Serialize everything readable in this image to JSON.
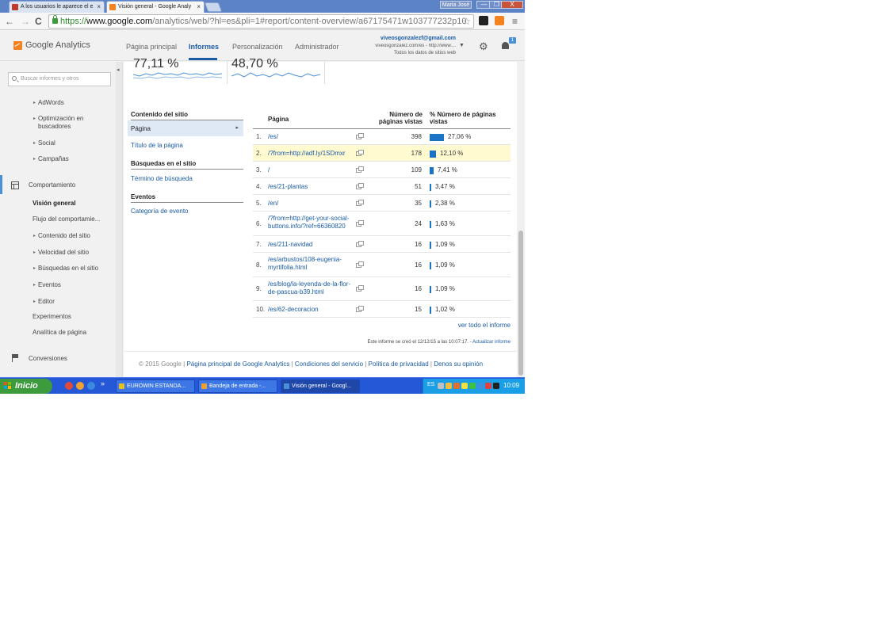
{
  "browser": {
    "tabs": [
      {
        "title": "A los usuarios le aparece el e",
        "favicon_color": "#c0392b"
      },
      {
        "title": "Visión general - Google Analy",
        "favicon_color": "#f58220"
      }
    ],
    "tab_close_glyph": "×",
    "username": "Maria José",
    "window_minimize": "—",
    "window_maximize": "❐",
    "window_close": "X",
    "url_scheme": "https://",
    "url_host": "www.google.com",
    "url_rest": "/analytics/web/?hl=es&pli=1#report/content-overview/a67175471w103777232p10",
    "nav_back": "←",
    "nav_forward": "→",
    "nav_reload": "C",
    "menu_glyph": "≡"
  },
  "ga": {
    "logo_text": "Google Analytics",
    "nav": [
      "Página principal",
      "Informes",
      "Personalización",
      "Administrador"
    ],
    "account_email": "viveosgonzalezf@gmail.com",
    "account_property": "viveosgonzalez.com/es - http://www....",
    "account_view": "Todos los datos de sitios web",
    "dropdown_glyph": "▼",
    "gear_glyph": "⚙",
    "notifications_count": "1"
  },
  "leftnav": {
    "search_placeholder": "Buscar informes y otros",
    "collapse_glyph": "◂",
    "adquisicion_items": [
      "AdWords",
      "Optimización en buscadores",
      "Social",
      "Campañas"
    ],
    "comportamiento_label": "Comportamiento",
    "comportamiento_items": [
      "Visión general",
      "Flujo del comportamie...",
      "Contenido del sitio",
      "Velocidad del sitio",
      "Búsquedas en el sitio",
      "Eventos",
      "Editor",
      "Experimentos",
      "Analítica de página"
    ],
    "conversiones_label": "Conversiones"
  },
  "metrics": [
    "77,11 %",
    "48,70 %"
  ],
  "sidepanel": {
    "contenido_heading": "Contenido del sitio",
    "pagina_label": "Página",
    "arrow_glyph": "▸",
    "titulo_link": "Título de la página",
    "busquedas_heading": "Búsquedas en el sitio",
    "termino_link": "Término de búsqueda",
    "eventos_heading": "Eventos",
    "categoria_link": "Categoría de evento"
  },
  "table": {
    "col_page": "Página",
    "col_views": "Número de páginas vistas",
    "col_pct": "% Número de páginas vistas",
    "accent_color": "#1a73c4",
    "highlight_color": "#fffad0",
    "rows": [
      {
        "index": "1.",
        "page": "/es/",
        "views": "398",
        "pct": "27,06 %",
        "share": 27.06
      },
      {
        "index": "2.",
        "page": "/?from=http://adf.ly/1SDmxr",
        "views": "178",
        "pct": "12,10 %",
        "share": 12.1
      },
      {
        "index": "3.",
        "page": "/",
        "views": "109",
        "pct": "7,41 %",
        "share": 7.41
      },
      {
        "index": "4.",
        "page": "/es/21-plantas",
        "views": "51",
        "pct": "3,47 %",
        "share": 3.47
      },
      {
        "index": "5.",
        "page": "/en/",
        "views": "35",
        "pct": "2,38 %",
        "share": 2.38
      },
      {
        "index": "6.",
        "page": "/?from=http://get-your-social-buttons.info/?ref=66360820",
        "views": "24",
        "pct": "1,63 %",
        "share": 1.63
      },
      {
        "index": "7.",
        "page": "/es/211-navidad",
        "views": "16",
        "pct": "1,09 %",
        "share": 1.09
      },
      {
        "index": "8.",
        "page": "/es/arbustos/108-eugenia-myrtifolia.html",
        "views": "16",
        "pct": "1,09 %",
        "share": 1.09
      },
      {
        "index": "9.",
        "page": "/es/blog/la-leyenda-de-la-flor-de-pascua-b39.html",
        "views": "16",
        "pct": "1,09 %",
        "share": 1.09
      },
      {
        "index": "10.",
        "page": "/es/62-decoracion",
        "views": "15",
        "pct": "1,02 %",
        "share": 1.02
      }
    ]
  },
  "report": {
    "see_all": "ver todo el informe",
    "created_note": "Este informe se creó el 12/12/15 a las 10:07:17. - ",
    "update_link": "Actualizar informe"
  },
  "footer": {
    "copyright": "© 2015 Google",
    "links": [
      "Página principal de Google Analytics",
      "Condiciones del servicio",
      "Política de privacidad",
      "Denos su opinión"
    ],
    "separator": " | "
  },
  "taskbar": {
    "start_label": "Inicio",
    "more_glyph": "»",
    "buttons": [
      {
        "label": "EUROWIN ESTANDA...",
        "icon_color": "#e8c020"
      },
      {
        "label": "Bandeja de entrada -...",
        "icon_color": "#f0a030"
      },
      {
        "label": "Visión general - Googl...",
        "icon_color": "#4a90d9"
      }
    ],
    "language": "ES",
    "clock": "10:09"
  }
}
